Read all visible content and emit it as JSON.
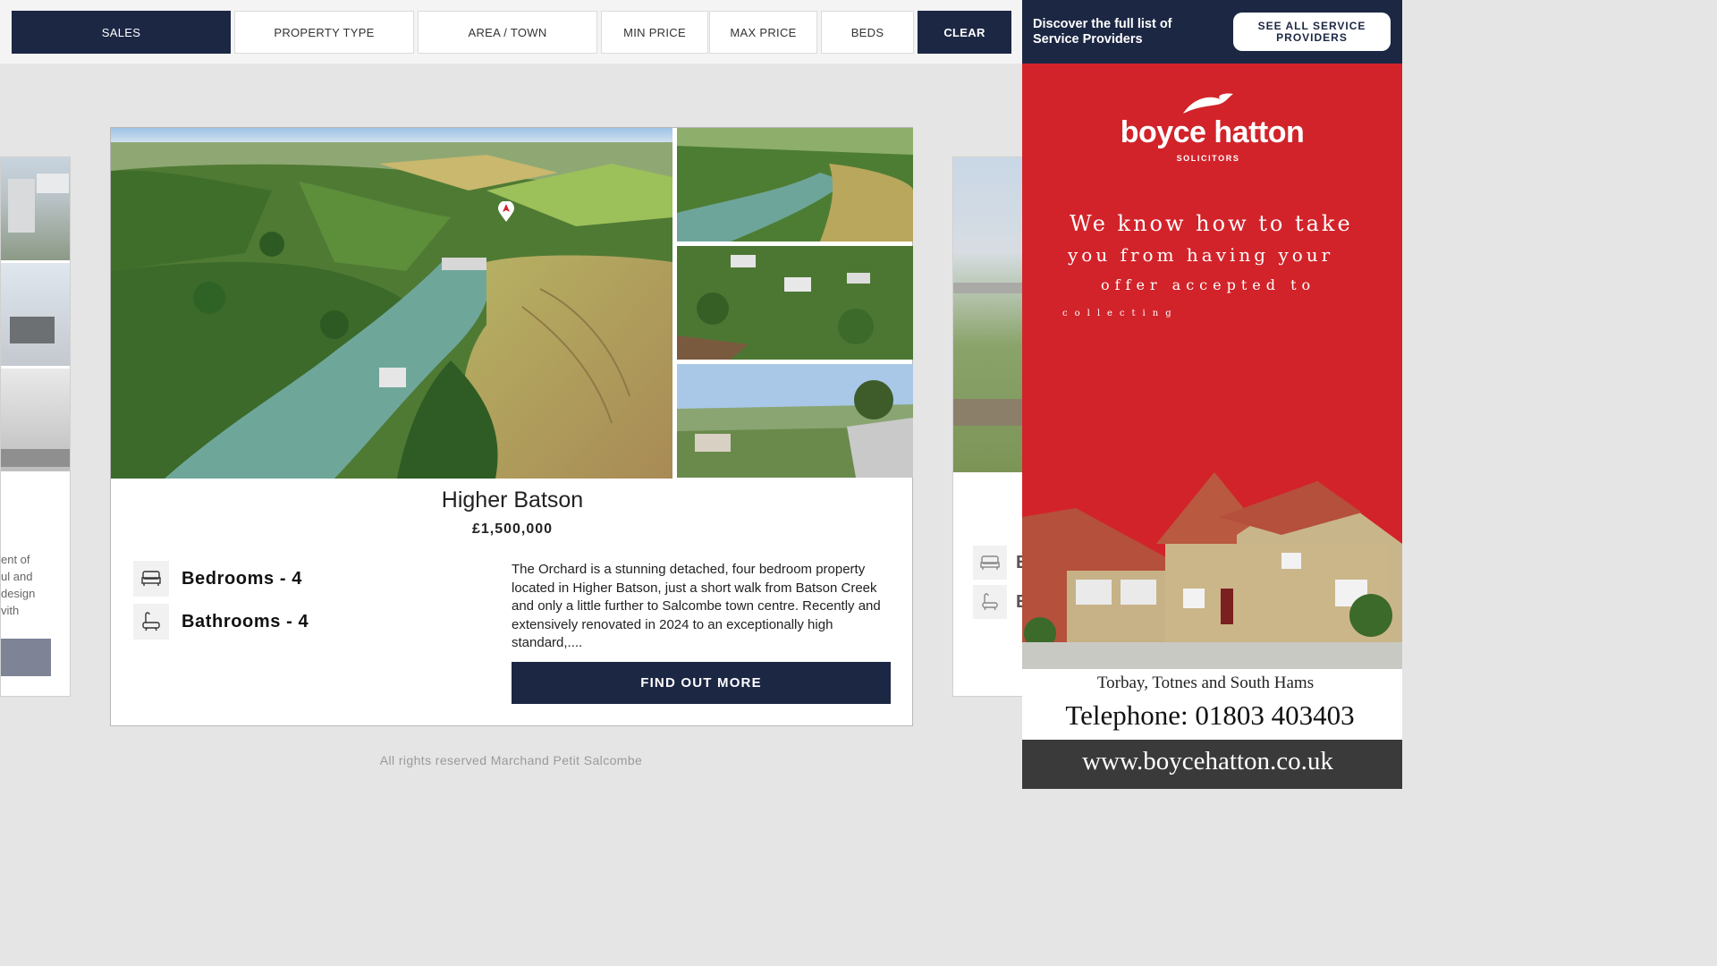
{
  "filters": {
    "sales": "SALES",
    "property_type": "PROPERTY TYPE",
    "area_town": "AREA / TOWN",
    "min_price": "MIN PRICE",
    "max_price": "MAX PRICE",
    "beds": "BEDS",
    "clear": "CLEAR"
  },
  "left_card": {
    "text_fragment": "ent of\nul and\ndesign\nvith"
  },
  "right_card": {
    "bed_fragment": "E",
    "bath_fragment": "E"
  },
  "listing": {
    "title": "Higher Batson",
    "price": "£1,500,000",
    "bedrooms": "Bedrooms - 4",
    "bathrooms": "Bathrooms - 4",
    "description": "The Orchard is a stunning detached, four bedroom property located in Higher Batson, just a short walk from Batson Creek and only a little further to Salcombe town centre. Recently and extensively renovated in 2024 to an exceptionally high standard,....",
    "cta": "FIND OUT MORE"
  },
  "footer": "All rights reserved Marchand Petit Salcombe",
  "ad_header": {
    "text": "Discover the full list of Service Providers",
    "button": "SEE ALL SERVICE PROVIDERS"
  },
  "ad": {
    "brand": "boyce hatton",
    "brand_sub": "SOLICITORS",
    "slogan_1": "We know how to take",
    "slogan_2": "you from having your",
    "slogan_3": "offer accepted to",
    "slogan_4": "collecting",
    "region": "Torbay, Totnes and South Hams",
    "phone": "Telephone: 01803 403403",
    "url": "www.boycehatton.co.uk"
  },
  "colors": {
    "navy": "#1c2744",
    "ad_red": "#d2232a",
    "background": "#e5e5e5"
  },
  "icons": [
    "bed-icon",
    "bath-icon",
    "map-pin-icon",
    "swoosh-logo-icon"
  ]
}
